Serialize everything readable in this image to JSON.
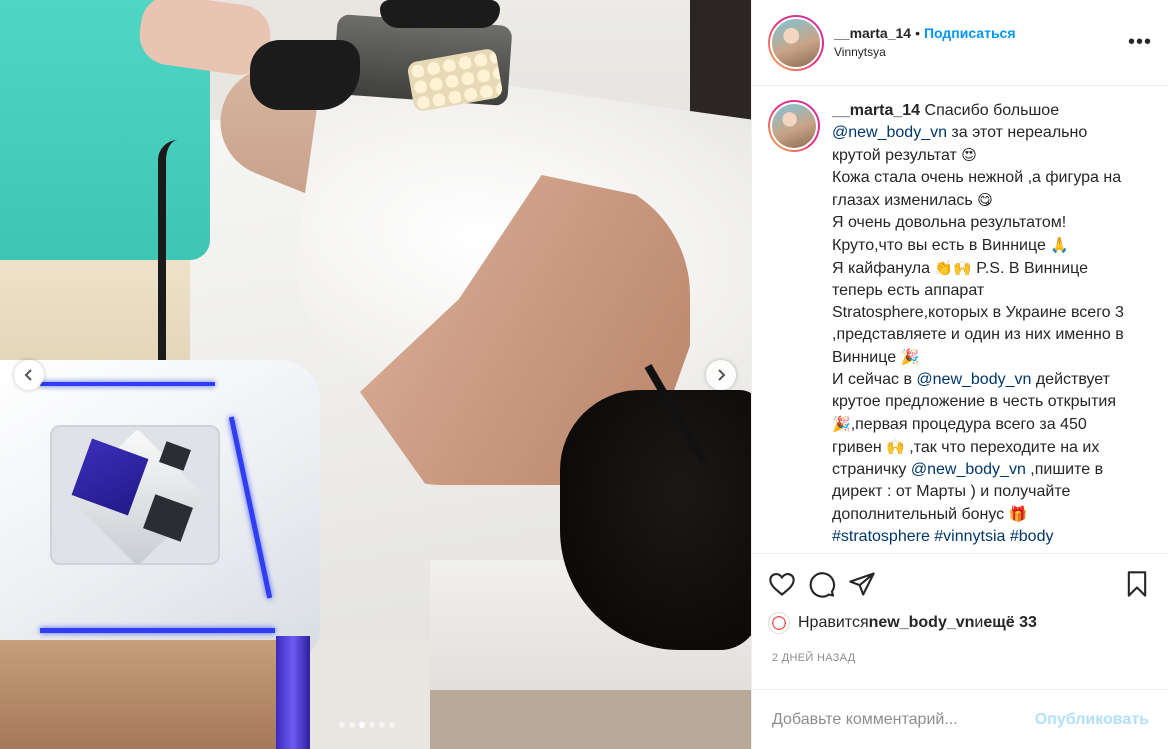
{
  "post": {
    "username": "__marta_14",
    "separator": "•",
    "follow_label": "Подписаться",
    "location": "Vinnytsya",
    "more_label": "•••",
    "carousel": {
      "slide_count": 6,
      "active_index": 2
    }
  },
  "caption": {
    "username": "__marta_14",
    "t1": " Спасибо большое ",
    "mention1": "@new_body_vn",
    "t2": " за этот нереально крутой результат ",
    "e1": "😍",
    "t3": "Кожа стала очень нежной ,а фигура на глазах изменилась ",
    "e2": "😋",
    "t4": "Я очень довольна результатом! Круто,что вы есть в Виннице ",
    "e3": "🙏",
    "t5": "Я кайфанула ",
    "e4": "👏🙌",
    "t6": " P.S. В Виннице теперь есть аппарат Stratosphere,которых в Украине всего 3 ,представляете и один из них именно в Виннице ",
    "e5": "🎉",
    "t7": "И сейчас в ",
    "mention2": "@new_body_vn",
    "t8": " действует крутое предложение в честь открытия ",
    "e6": "🎉",
    "t9": ",первая процедура всего за 450 гривен ",
    "e7": "🙌",
    "t10": " ,так что переходите на их страничку ",
    "mention3": "@new_body_vn",
    "t11": " ,пишите в директ : от Марты ) и получайте дополнительный бонус ",
    "e8": "🎁",
    "hashtags": "#stratosphere #vinnytsia #body"
  },
  "actions": {
    "like_icon": "heart-icon",
    "comment_icon": "comment-icon",
    "share_icon": "share-icon",
    "save_icon": "bookmark-icon"
  },
  "likes": {
    "prefix": "Нравится ",
    "user": "new_body_vn",
    "middle": " и ",
    "others": "ещё 33"
  },
  "date": "2 ДНЕЙ НАЗАД",
  "comment": {
    "placeholder": "Добавьте комментарий...",
    "publish_label": "Опубликовать"
  }
}
